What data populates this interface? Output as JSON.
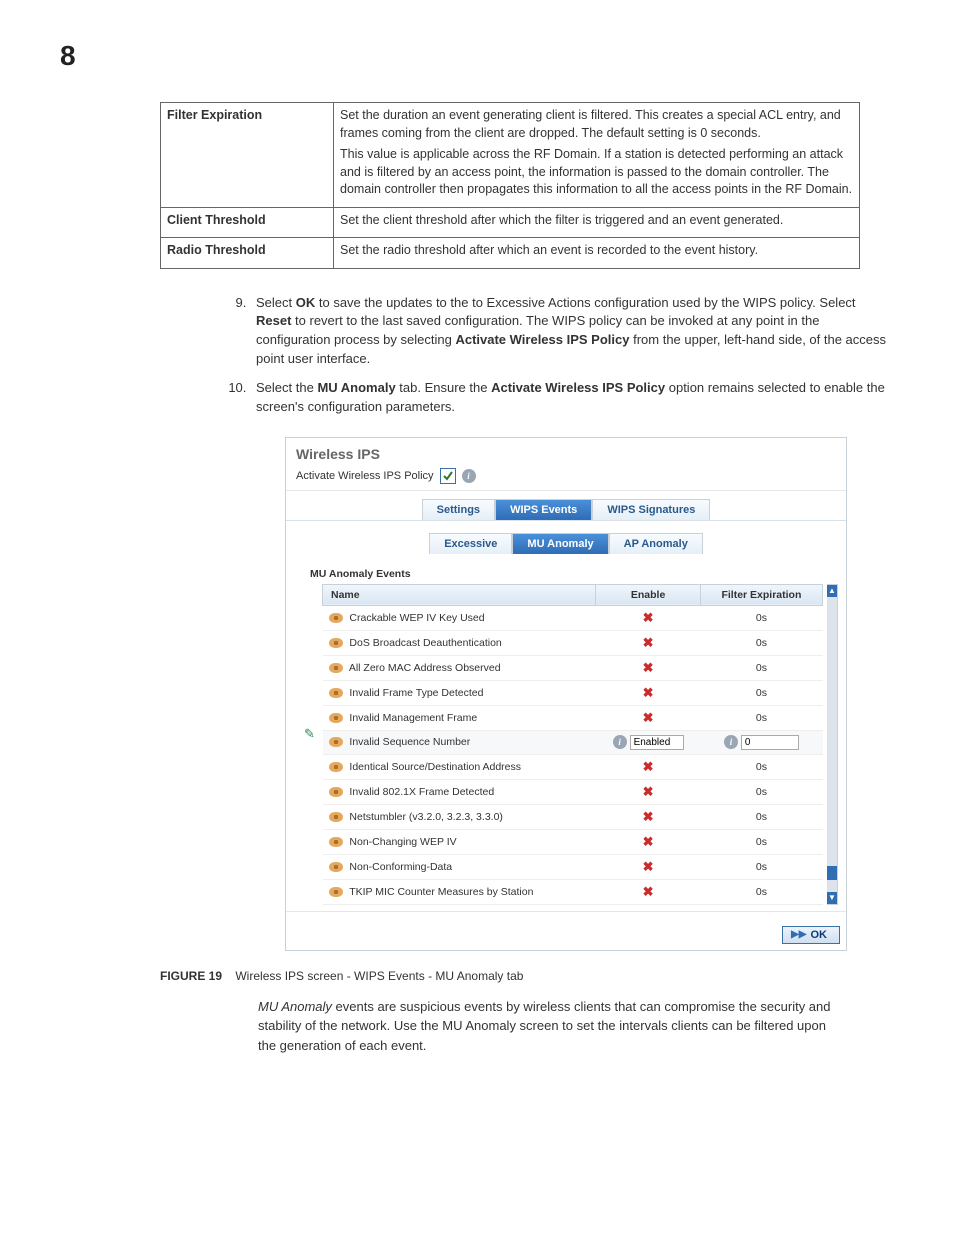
{
  "pageNumber": "8",
  "defTable": [
    {
      "term": "Filter Expiration",
      "desc": [
        "Set the duration an event generating client is filtered. This creates a special ACL entry, and frames coming from the client are dropped. The default setting is 0 seconds.",
        "This value is applicable across the RF Domain. If a station is detected performing an attack and is filtered by an access point, the information is passed to the domain controller. The domain controller then propagates this information to all the access points in the RF Domain."
      ]
    },
    {
      "term": "Client Threshold",
      "desc": [
        "Set the client threshold after which the filter is triggered and an event generated."
      ]
    },
    {
      "term": "Radio Threshold",
      "desc": [
        "Set the radio threshold after which an event is recorded to the event history."
      ]
    }
  ],
  "steps": {
    "start": 9,
    "items": [
      {
        "pre": "Select ",
        "b1": "OK",
        "mid1": " to save the updates to the to Excessive Actions configuration used by the WIPS policy. Select ",
        "b2": "Reset",
        "mid2": " to revert to the last saved configuration. The WIPS policy can be invoked at any point in the configuration process by selecting ",
        "b3": "Activate Wireless IPS Policy",
        "post": " from the upper, left-hand side, of the access point user interface."
      },
      {
        "pre": "Select the ",
        "b1": "MU Anomaly",
        "mid1": " tab. Ensure the ",
        "b2": "Activate Wireless IPS Policy",
        "post": " option remains selected to enable the screen's configuration parameters."
      }
    ]
  },
  "app": {
    "title": "Wireless IPS",
    "activateLabel": "Activate Wireless IPS Policy",
    "tabs": [
      "Settings",
      "WIPS Events",
      "WIPS Signatures"
    ],
    "activeTab": 1,
    "subtabs": [
      "Excessive",
      "MU Anomaly",
      "AP Anomaly"
    ],
    "activeSubtab": 1,
    "groupLabel": "MU Anomaly Events",
    "columns": {
      "name": "Name",
      "enable": "Enable",
      "filter": "Filter Expiration"
    },
    "selectedRow": 5,
    "enabledText": "Enabled",
    "filterInputValue": "0",
    "okLabel": "OK",
    "rows": [
      {
        "name": "Crackable WEP IV Key Used",
        "filter": "0s"
      },
      {
        "name": "DoS Broadcast Deauthentication",
        "filter": "0s"
      },
      {
        "name": "All Zero MAC Address Observed",
        "filter": "0s"
      },
      {
        "name": "Invalid Frame Type Detected",
        "filter": "0s"
      },
      {
        "name": "Invalid Management Frame",
        "filter": "0s"
      },
      {
        "name": "Invalid Sequence Number",
        "filter": "0s"
      },
      {
        "name": "Identical Source/Destination Address",
        "filter": "0s"
      },
      {
        "name": "Invalid 802.1X Frame Detected",
        "filter": "0s"
      },
      {
        "name": "Netstumbler (v3.2.0, 3.2.3, 3.3.0)",
        "filter": "0s"
      },
      {
        "name": "Non-Changing WEP IV",
        "filter": "0s"
      },
      {
        "name": "Non-Conforming-Data",
        "filter": "0s"
      },
      {
        "name": "TKIP MIC Counter Measures by Station",
        "filter": "0s"
      }
    ]
  },
  "figure": {
    "label": "FIGURE 19",
    "caption": "Wireless IPS screen - WIPS Events - MU Anomaly tab"
  },
  "bodyPara": {
    "lead": "MU Anomaly",
    "rest": " events are suspicious events by wireless clients that can compromise the security and stability of the network. Use the MU Anomaly screen to set the intervals clients can be filtered upon the generation of each event."
  }
}
